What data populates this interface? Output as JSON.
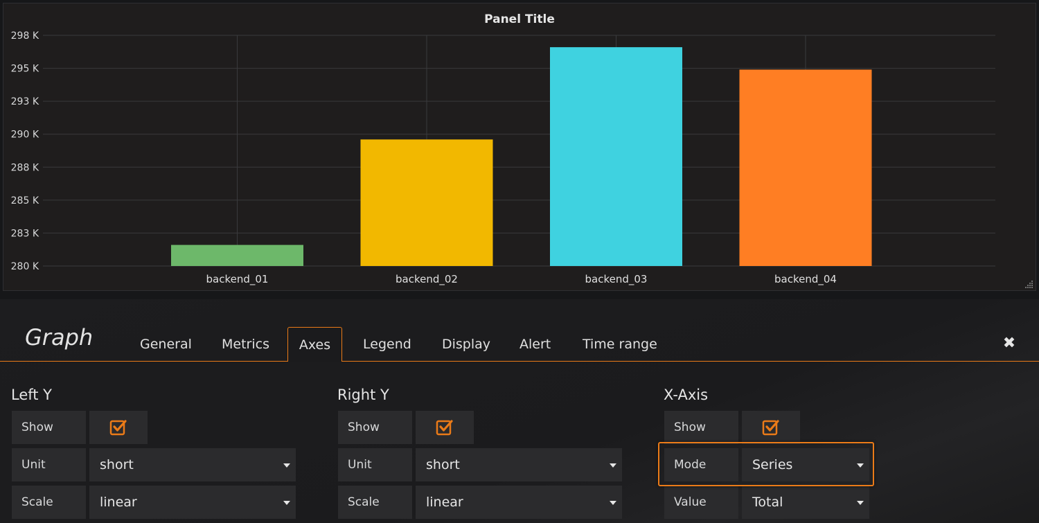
{
  "panel": {
    "title": "Panel Title"
  },
  "chart_data": {
    "type": "bar",
    "categories": [
      "backend_01",
      "backend_02",
      "backend_03",
      "backend_04"
    ],
    "values": [
      281600,
      289600,
      296600,
      294900
    ],
    "colors": [
      "#6db86a",
      "#f2b800",
      "#3fd2e0",
      "#ff7e23"
    ],
    "yticks": [
      280000,
      282500,
      285000,
      287500,
      290000,
      292500,
      295000,
      297500
    ],
    "ytick_labels": [
      "280 K",
      "283 K",
      "285 K",
      "288 K",
      "290 K",
      "293 K",
      "295 K",
      "298 K"
    ],
    "ylim": [
      280000,
      297500
    ],
    "grid": true
  },
  "editor": {
    "title": "Graph",
    "tabs": [
      "General",
      "Metrics",
      "Axes",
      "Legend",
      "Display",
      "Alert",
      "Time range"
    ],
    "active_tab": "Axes",
    "close_icon": "close-icon"
  },
  "left_y": {
    "title": "Left Y",
    "show_label": "Show",
    "show": true,
    "unit_label": "Unit",
    "unit": "short",
    "scale_label": "Scale",
    "scale": "linear"
  },
  "right_y": {
    "title": "Right Y",
    "show_label": "Show",
    "show": true,
    "unit_label": "Unit",
    "unit": "short",
    "scale_label": "Scale",
    "scale": "linear"
  },
  "x_axis": {
    "title": "X-Axis",
    "show_label": "Show",
    "show": true,
    "mode_label": "Mode",
    "mode": "Series",
    "value_label": "Value",
    "value": "Total"
  },
  "colors": {
    "accent": "#eb7b18"
  }
}
